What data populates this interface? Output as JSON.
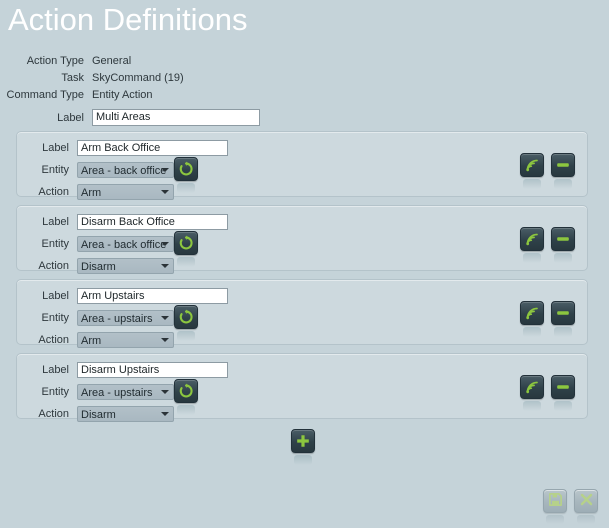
{
  "page": {
    "title": "Action Definitions",
    "background_color": "#c5d3d9",
    "title_color": "#ffffff"
  },
  "meta": {
    "rows": [
      {
        "label": "Action Type",
        "value": "General"
      },
      {
        "label": "Task",
        "value": "SkyCommand (19)"
      },
      {
        "label": "Command Type",
        "value": "Entity Action"
      }
    ]
  },
  "label_field": {
    "label": "Label",
    "value": "Multi Areas",
    "placeholder": ""
  },
  "field_labels": {
    "label": "Label",
    "entity": "Entity",
    "action": "Action"
  },
  "icons": {
    "refresh": "refresh-icon",
    "broadcast": "broadcast-icon",
    "remove": "minus-icon",
    "add": "plus-icon",
    "save": "floppy-disk-icon",
    "cancel": "close-x-icon"
  },
  "colors": {
    "accent_green": "#8cc63f",
    "panel": "#cdd9de",
    "panel_border": "#b4c3ca",
    "dark_button": "#2f4149",
    "input_bg": "#ffffff"
  },
  "groups": [
    {
      "label_value": "Arm Back Office",
      "entity_value": "Area - back office",
      "action_value": "Arm"
    },
    {
      "label_value": "Disarm Back Office",
      "entity_value": "Area - back office",
      "action_value": "Disarm"
    },
    {
      "label_value": "Arm Upstairs",
      "entity_value": "Area - upstairs",
      "action_value": "Arm"
    },
    {
      "label_value": "Disarm Upstairs",
      "entity_value": "Area - upstairs",
      "action_value": "Disarm"
    }
  ],
  "buttons": {
    "add": "Add action",
    "save": "Save",
    "cancel": "Cancel",
    "remove": "Remove action",
    "test": "Test action",
    "refresh": "Refresh"
  }
}
